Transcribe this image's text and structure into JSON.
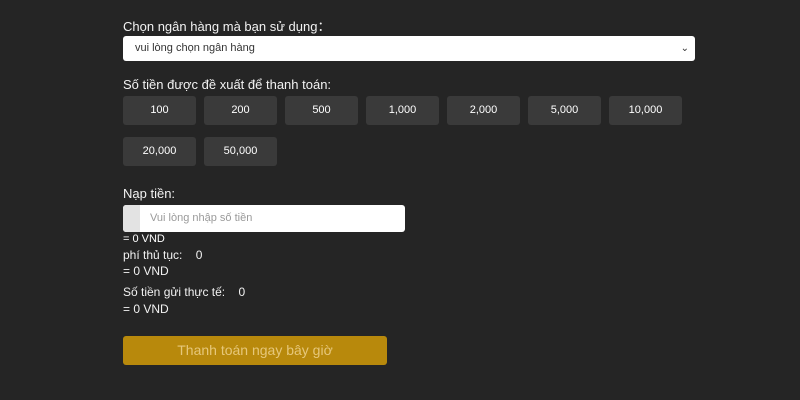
{
  "bank": {
    "label": "Chọn ngân hàng mà bạn sử dụng：",
    "selected": "vui lòng chọn ngân hàng",
    "chevron_icon": "chevron-down-icon"
  },
  "suggested": {
    "label": "Số tiền được đề xuất để thanh toán:",
    "amounts": [
      "100",
      "200",
      "500",
      "1,000",
      "2,000",
      "5,000",
      "10,000",
      "20,000",
      "50,000"
    ]
  },
  "deposit": {
    "label": "Nạp tiền:",
    "placeholder": "Vui lòng nhập số tiền",
    "converted": "= 0 VND"
  },
  "fee": {
    "label": "phí thủ tục:",
    "value": "0",
    "converted": "= 0 VND"
  },
  "actual": {
    "label": "Số tiền gửi thực tế:",
    "value": "0",
    "converted": "= 0 VND"
  },
  "submit": {
    "label": "Thanh toán ngay bây giờ",
    "color": "#b8890c"
  }
}
